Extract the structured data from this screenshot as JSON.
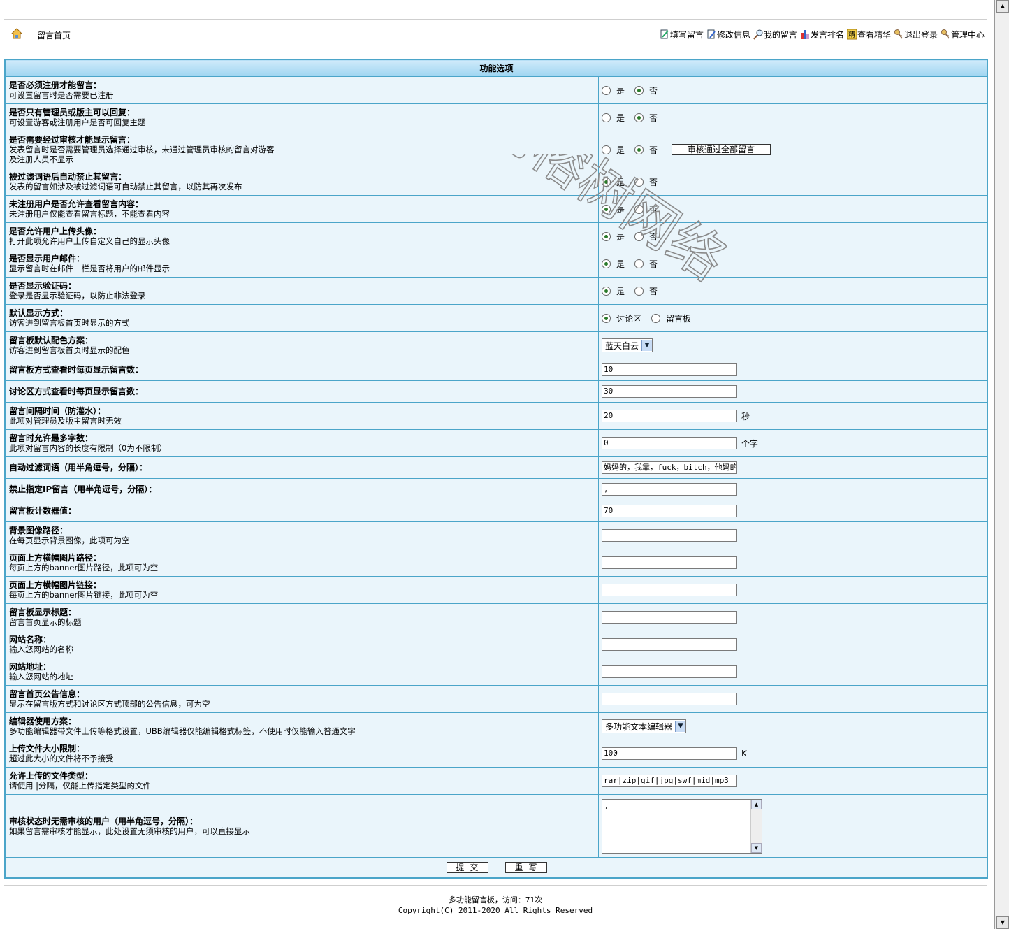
{
  "header": {
    "home_label": "留言首页",
    "nav": [
      {
        "icon": "write-icon",
        "label": "填写留言"
      },
      {
        "icon": "edit-icon",
        "label": "修改信息"
      },
      {
        "icon": "search-icon",
        "label": "我的留言"
      },
      {
        "icon": "chart-icon",
        "label": "发言排名"
      },
      {
        "icon": "featured-icon",
        "label": "查看精华",
        "badge": "精"
      },
      {
        "icon": "key-icon",
        "label": "退出登录"
      },
      {
        "icon": "admin-icon",
        "label": "管理中心"
      }
    ]
  },
  "table": {
    "heading": "功能选项",
    "rows": [
      {
        "title": "是否必须注册才能留言：",
        "desc": [
          "可设置留言时是否需要已注册"
        ],
        "type": "radio",
        "options": [
          "是",
          "否"
        ],
        "selected": 1,
        "h": 39
      },
      {
        "title": "是否只有管理员或版主可以回复：",
        "desc": [
          "可设置游客或注册用户是否可回复主题"
        ],
        "type": "radio",
        "options": [
          "是",
          "否"
        ],
        "selected": 1,
        "h": 39
      },
      {
        "title": "是否需要经过审核才能显示留言：",
        "desc": [
          "发表留言时是否需要管理员选择通过审核，未通过管理员审核的留言对游客",
          "及注册人员不显示"
        ],
        "type": "radio",
        "options": [
          "是",
          "否"
        ],
        "selected": 1,
        "button": "审核通过全部留言",
        "h": 53
      },
      {
        "title": "被过滤词语后自动禁止其留言：",
        "desc": [
          "发表的留言如涉及被过滤词语可自动禁止其留言，以防其再次发布"
        ],
        "type": "radio",
        "options": [
          "是",
          "否"
        ],
        "selected": 0,
        "h": 39
      },
      {
        "title": "未注册用户是否允许查看留言内容：",
        "desc": [
          "未注册用户仅能查看留言标题，不能查看内容"
        ],
        "type": "radio",
        "options": [
          "是",
          "否"
        ],
        "selected": 0,
        "h": 39
      },
      {
        "title": "是否允许用户上传头像：",
        "desc": [
          "打开此项允许用户上传自定义自己的显示头像"
        ],
        "type": "radio",
        "options": [
          "是",
          "否"
        ],
        "selected": 0,
        "h": 39
      },
      {
        "title": "是否显示用户邮件：",
        "desc": [
          "显示留言时在邮件一栏是否将用户的邮件显示"
        ],
        "type": "radio",
        "options": [
          "是",
          "否"
        ],
        "selected": 0,
        "h": 39
      },
      {
        "title": "是否显示验证码：",
        "desc": [
          "登录是否显示验证码，以防止非法登录"
        ],
        "type": "radio",
        "options": [
          "是",
          "否"
        ],
        "selected": 0,
        "h": 39
      },
      {
        "title": "默认显示方式：",
        "desc": [
          "访客进到留言板首页时显示的方式"
        ],
        "type": "radio",
        "options": [
          "讨论区",
          "留言板"
        ],
        "selected": 0,
        "h": 39
      },
      {
        "title": "留言板默认配色方案：",
        "desc": [
          "访客进到留言板首页时显示的配色"
        ],
        "type": "select",
        "value": "蓝天白云",
        "h": 39
      },
      {
        "title": "留言板方式查看时每页显示留言数：",
        "desc": [],
        "type": "text",
        "value": "10",
        "h": 31
      },
      {
        "title": "讨论区方式查看时每页显示留言数：",
        "desc": [],
        "type": "text",
        "value": "30",
        "h": 31
      },
      {
        "title": "留言间隔时间（防灌水）：",
        "desc": [
          "此项对管理员及版主留言时无效"
        ],
        "type": "text",
        "value": "20",
        "unit": "秒",
        "h": 39
      },
      {
        "title": "留言时允许最多字数：",
        "desc": [
          "此项对留言内容的长度有限制（0为不限制）"
        ],
        "type": "text",
        "value": "0",
        "unit": "个字",
        "h": 39
      },
      {
        "title": "自动过滤词语（用半角逗号，分隔）：",
        "desc": [],
        "type": "text",
        "value": "妈妈的，我靠，fuck，bitch，他妈的，性",
        "h": 31
      },
      {
        "title": "禁止指定IP留言（用半角逗号，分隔）：",
        "desc": [],
        "type": "text",
        "value": ",",
        "h": 31
      },
      {
        "title": "留言板计数器值：",
        "desc": [],
        "type": "text",
        "value": "70",
        "h": 31
      },
      {
        "title": "背景图像路径：",
        "desc": [
          "在每页显示背景图像，此项可为空"
        ],
        "type": "text",
        "value": "",
        "h": 39
      },
      {
        "title": "页面上方横幅图片路径：",
        "desc": [
          "每页上方的banner图片路径，此项可为空"
        ],
        "type": "text",
        "value": "",
        "h": 39
      },
      {
        "title": "页面上方横幅图片链接：",
        "desc": [
          "每页上方的banner图片链接，此项可为空"
        ],
        "type": "text",
        "value": "",
        "h": 39
      },
      {
        "title": "留言板显示标题：",
        "desc": [
          "留言首页显示的标题"
        ],
        "type": "text",
        "value": "",
        "h": 39
      },
      {
        "title": "网站名称：",
        "desc": [
          "输入您网站的名称"
        ],
        "type": "text",
        "value": "",
        "h": 39
      },
      {
        "title": "网站地址：",
        "desc": [
          "输入您网站的地址"
        ],
        "type": "text",
        "value": "",
        "h": 39
      },
      {
        "title": "留言首页公告信息：",
        "desc": [
          "显示在留言版方式和讨论区方式顶部的公告信息，可为空"
        ],
        "type": "text",
        "value": "",
        "h": 39
      },
      {
        "title": "编辑器使用方案：",
        "desc": [
          "多功能编辑器带文件上传等格式设置，UBB编辑器仅能编辑格式标签，不使用时仅能输入普通文字"
        ],
        "type": "select",
        "value": "多功能文本编辑器",
        "h": 39
      },
      {
        "title": "上传文件大小限制：",
        "desc": [
          "超过此大小的文件将不予接受"
        ],
        "type": "text",
        "value": "100",
        "unit": "K",
        "h": 39
      },
      {
        "title": "允许上传的文件类型：",
        "desc": [
          "请使用 |分隔，仅能上传指定类型的文件"
        ],
        "type": "text",
        "value": "rar|zip|gif|jpg|swf|mid|mp3",
        "h": 39
      },
      {
        "title": "审核状态时无需审核的用户（用半角逗号，分隔）：",
        "desc": [
          "如果留言需审核才能显示，此处设置无须审核的用户，可以直接显示"
        ],
        "type": "textarea",
        "value": ",",
        "h": 90
      }
    ],
    "submit": "提交",
    "reset": "重写"
  },
  "footer": {
    "line1": "多功能留言板，访问：71次",
    "line2": "Copyright(C) 2011-2020 All Rights Reserved"
  },
  "watermark": "老榕树网络",
  "colors": {
    "border": "#4ba5c9",
    "cell_bg": "#eaf5fb",
    "header_bg": "#9fd5f1"
  }
}
